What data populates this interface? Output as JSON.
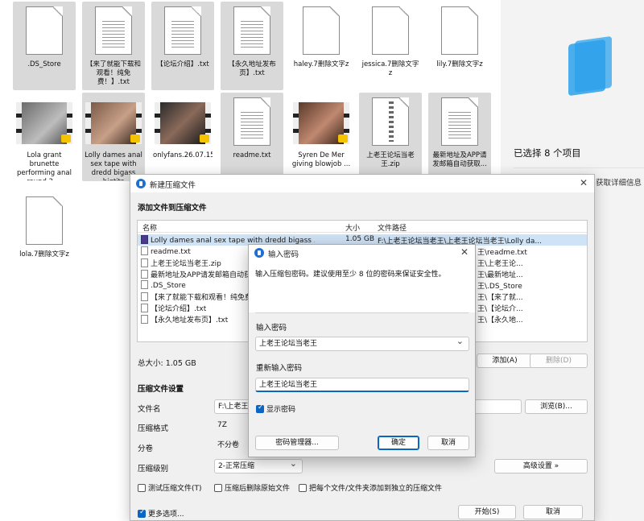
{
  "files": [
    {
      "name": ".DS_Store",
      "kind": "doc",
      "selected": true
    },
    {
      "name": "【来了就能下载和观看！纯免费！】.txt",
      "kind": "txt",
      "selected": true
    },
    {
      "name": "【论坛介绍】.txt",
      "kind": "txt",
      "selected": true
    },
    {
      "name": "【永久地址发布页】.txt",
      "kind": "txt",
      "selected": true
    },
    {
      "name": "haley.7删除文字z",
      "kind": "doc",
      "selected": false
    },
    {
      "name": "jessica.7删除文字z",
      "kind": "doc",
      "selected": false
    },
    {
      "name": "lily.7删除文字z",
      "kind": "doc",
      "selected": false
    },
    {
      "name": "Lola grant brunette performing anal round 2 ...",
      "kind": "video",
      "selected": false
    },
    {
      "name": "Lolly dames anal sex tape with dredd bigass bigtits",
      "kind": "video",
      "selected": true
    },
    {
      "name": "onlyfans.26.07.15.abbie.sykes.a...",
      "kind": "video",
      "selected": false
    },
    {
      "name": "readme.txt",
      "kind": "txt",
      "selected": true
    },
    {
      "name": "Syren De Mer giving blowjob ...",
      "kind": "video",
      "selected": false
    },
    {
      "name": "上老王论坛当老王.zip",
      "kind": "zip",
      "selected": true
    },
    {
      "name": "最新地址及APP请发邮箱自动获取...",
      "kind": "txt",
      "selected": true
    },
    {
      "name": "lola.7删除文字z",
      "kind": "doc",
      "selected": false
    }
  ],
  "details_pane": {
    "selection_text": "已选择 8 个项目",
    "hint": "获取详细信息"
  },
  "compress_dialog": {
    "title": "新建压缩文件",
    "add_section": "添加文件到压缩文件",
    "columns": {
      "name": "名称",
      "size": "大小",
      "path": "文件路径"
    },
    "rows": [
      {
        "name": "Lolly dames anal sex tape with dredd bigass ...",
        "size": "1.05 GB",
        "path": "F:\\上老王论坛当老王\\上老王论坛当老王\\Lolly da...",
        "icon": "video",
        "selected": true
      },
      {
        "name": "readme.txt",
        "size": "",
        "path": "王\\readme.txt",
        "icon": "file",
        "selected": false
      },
      {
        "name": "上老王论坛当老王.zip",
        "size": "",
        "path": "王\\上老王论...",
        "icon": "file",
        "selected": false
      },
      {
        "name": "最新地址及APP请发邮箱自动获",
        "size": "",
        "path": "王\\最新地址...",
        "icon": "file",
        "selected": false
      },
      {
        "name": ".DS_Store",
        "size": "",
        "path": "王\\.DS_Store",
        "icon": "file",
        "selected": false
      },
      {
        "name": "【来了就能下载和观看！纯免费",
        "size": "",
        "path": "王\\【来了就...",
        "icon": "file",
        "selected": false
      },
      {
        "name": "【论坛介绍】.txt",
        "size": "",
        "path": "王\\【论坛介...",
        "icon": "file",
        "selected": false
      },
      {
        "name": "【永久地址发布页】.txt",
        "size": "",
        "path": "王\\【永久地...",
        "icon": "file",
        "selected": false
      }
    ],
    "total_size": "总大小: 1.05 GB",
    "add_button": "添加(A)",
    "delete_button": "删除(D)",
    "settings_section": "压缩文件设置",
    "filename_label": "文件名",
    "filename_value": "F:\\上老王论",
    "browse_button": "浏览(B)...",
    "format_label": "压缩格式",
    "format_value": "7Z",
    "split_label": "分卷",
    "split_value": "不分卷",
    "level_label": "压缩级别",
    "level_value": "2-正常压缩",
    "advanced_button": "高级设置 »",
    "opt_test": "测试压缩文件(T)",
    "opt_delete": "压缩后删除原始文件",
    "opt_each": "把每个文件/文件夹添加到独立的压缩文件",
    "more_options": "更多选项...",
    "start_button": "开始(S)",
    "cancel_button": "取消"
  },
  "password_dialog": {
    "title": "输入密码",
    "description": "输入压缩包密码。建议使用至少 8 位的密码来保证安全性。",
    "password_label": "输入密码",
    "password_value": "上老王论坛当老王",
    "confirm_label": "重新输入密码",
    "confirm_value": "上老王论坛当老王",
    "show_password": "显示密码",
    "manager_button": "密码管理器...",
    "ok_button": "确定",
    "cancel_button": "取消"
  },
  "colors": {
    "accent": "#0a66c2",
    "selection": "#d9d9d9",
    "row_selection": "#cfe3f6"
  }
}
